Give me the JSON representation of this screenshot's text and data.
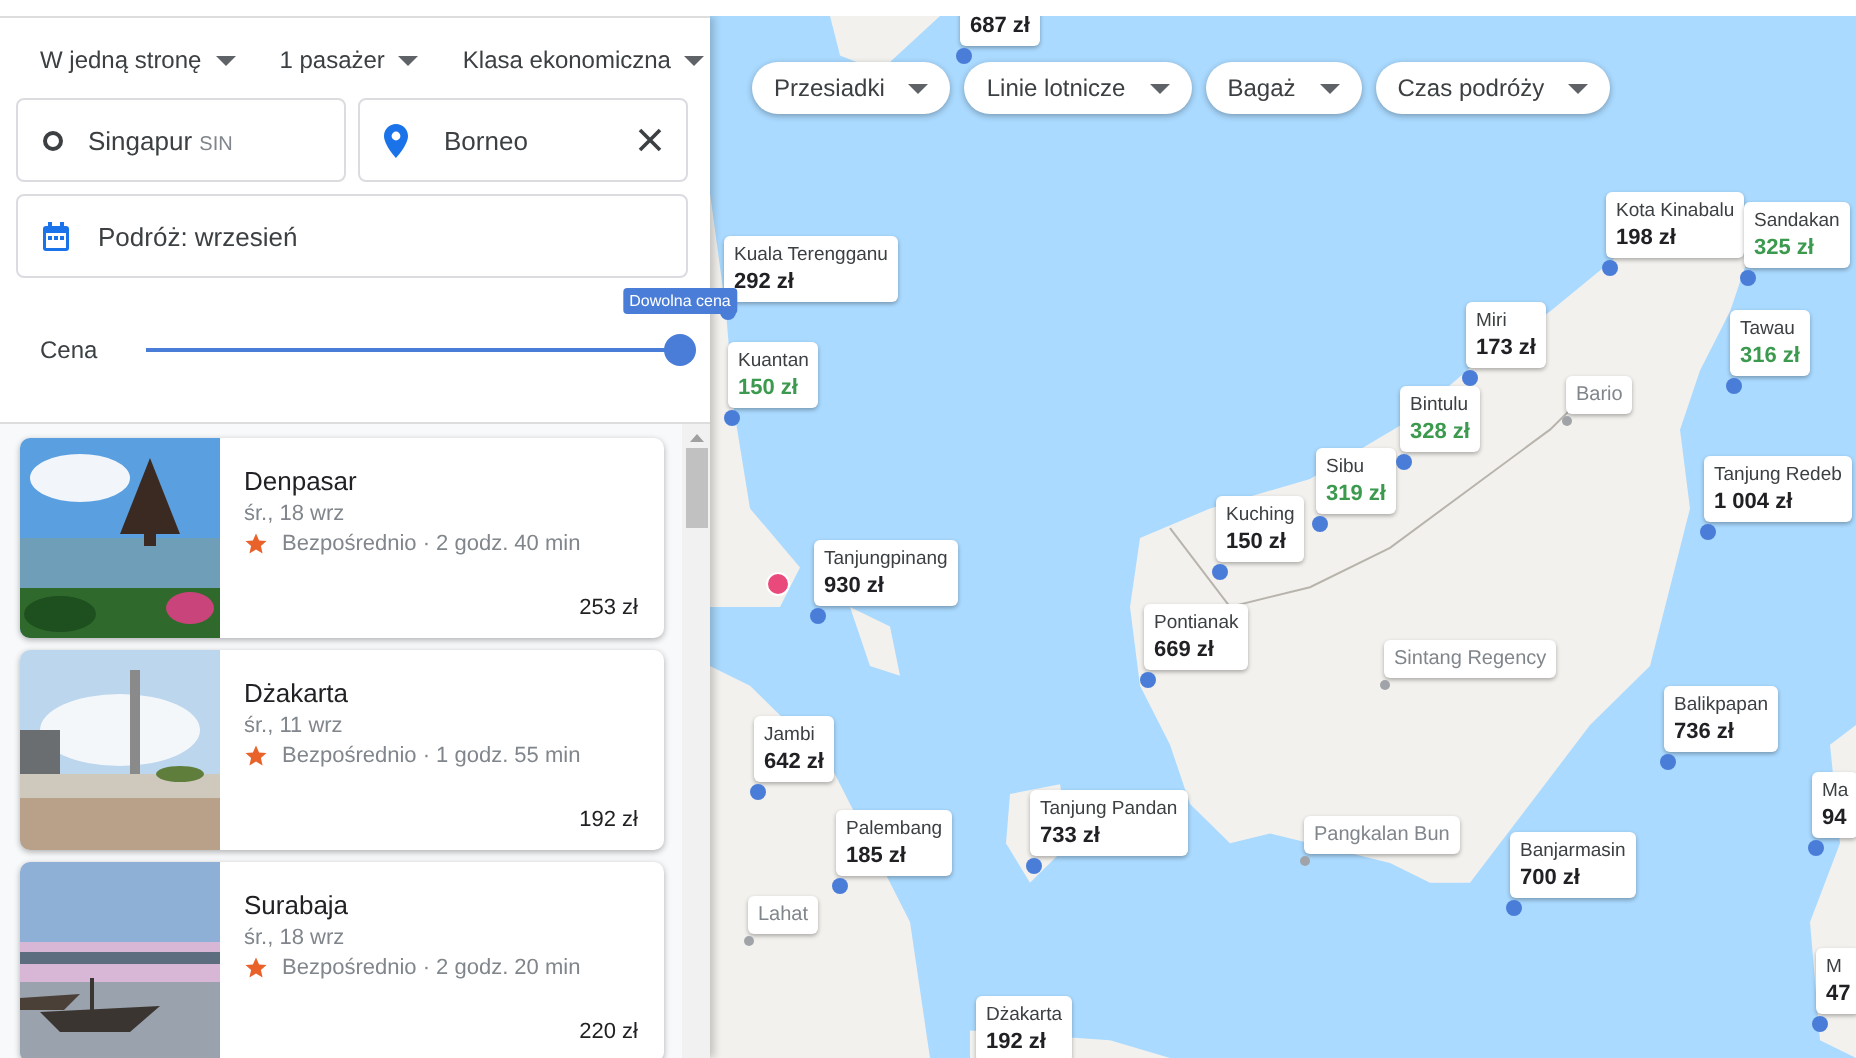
{
  "trip_options": [
    {
      "label": "W jedną stronę"
    },
    {
      "label": "1 pasażer"
    },
    {
      "label": "Klasa ekonomiczna"
    }
  ],
  "origin": {
    "city": "Singapur",
    "code": "SIN"
  },
  "destination": {
    "value": "Borneo"
  },
  "dates": {
    "value": "Podróż: wrzesień"
  },
  "price_filter": {
    "label": "Cena",
    "tooltip": "Dowolna cena",
    "level": 1
  },
  "results": [
    {
      "city": "Denpasar",
      "date": "śr., 18 wrz",
      "details": "Bezpośrednio · 2 godz. 40 min",
      "price": "253 zł"
    },
    {
      "city": "Dżakarta",
      "date": "śr., 11 wrz",
      "details": "Bezpośrednio · 1 godz. 55 min",
      "price": "192 zł"
    },
    {
      "city": "Surabaja",
      "date": "śr., 18 wrz",
      "details": "Bezpośrednio · 2 godz. 20 min",
      "price": "220 zł"
    }
  ],
  "map": {
    "filters": [
      {
        "label": "Przesiadki"
      },
      {
        "label": "Linie lotnicze"
      },
      {
        "label": "Bagaż"
      },
      {
        "label": "Czas podróży"
      }
    ],
    "markers": [
      {
        "price": "687 zł",
        "cheap": false
      },
      {
        "name": "Kuala Terengganu",
        "price": "292 zł",
        "cheap": false
      },
      {
        "name": "Kuantan",
        "price": "150 zł",
        "cheap": true
      },
      {
        "name": "Tanjungpinang",
        "price": "930 zł",
        "cheap": false
      },
      {
        "name": "Kuching",
        "price": "150 zł",
        "cheap": false
      },
      {
        "name": "Sibu",
        "price": "319 zł",
        "cheap": true
      },
      {
        "name": "Bintulu",
        "price": "328 zł",
        "cheap": true
      },
      {
        "name": "Miri",
        "price": "173 zł",
        "cheap": false
      },
      {
        "name": "Bario"
      },
      {
        "name": "Kota Kinabalu",
        "price": "198 zł",
        "cheap": false
      },
      {
        "name": "Sandakan",
        "price": "325 zł",
        "cheap": true
      },
      {
        "name": "Tawau",
        "price": "316 zł",
        "cheap": true
      },
      {
        "name": "Tanjung Redeb",
        "price": "1 004 zł",
        "cheap": false
      },
      {
        "name": "Pontianak",
        "price": "669 zł",
        "cheap": false
      },
      {
        "name": "Sintang Regency"
      },
      {
        "name": "Jambi",
        "price": "642 zł",
        "cheap": false
      },
      {
        "name": "Palembang",
        "price": "185 zł",
        "cheap": false
      },
      {
        "name": "Lahat"
      },
      {
        "name": "Tanjung Pandan",
        "price": "733 zł",
        "cheap": false
      },
      {
        "name": "Pangkalan Bun"
      },
      {
        "name": "Banjarmasin",
        "price": "700 zł",
        "cheap": false
      },
      {
        "name": "Balikpapan",
        "price": "736 zł",
        "cheap": false
      },
      {
        "name": "Ma",
        "price": "94",
        "cheap": false
      },
      {
        "name": "M",
        "price": "47",
        "cheap": false
      },
      {
        "name": "Dżakarta",
        "price": "192 zł",
        "cheap": false
      }
    ]
  }
}
